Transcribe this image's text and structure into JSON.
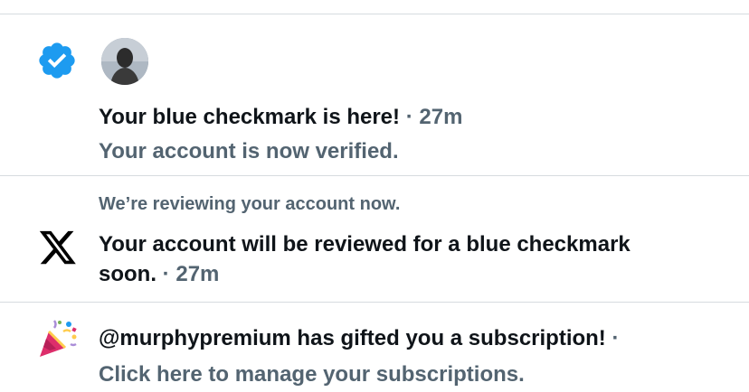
{
  "notifications": [
    {
      "icon": "verified-badge-icon",
      "avatar": "user-avatar",
      "title": "Your blue checkmark is here!",
      "separator": "·",
      "time": "27m",
      "body": "Your account is now verified."
    },
    {
      "icon": "x-logo-icon",
      "preface": "We’re reviewing your account now.",
      "title_line1": "Your account will be reviewed for a blue checkmark",
      "title_line2": "soon.",
      "separator": "·",
      "time": "27m"
    },
    {
      "icon": "party-popper-icon",
      "title": "@murphypremium has gifted you a subscription!",
      "separator": "·",
      "body": "Click here to manage your subscriptions."
    }
  ],
  "colors": {
    "primary_text": "#0f1419",
    "secondary_text": "#536471",
    "verified_blue": "#1d9bf0",
    "divider": "#d6dbdf"
  }
}
